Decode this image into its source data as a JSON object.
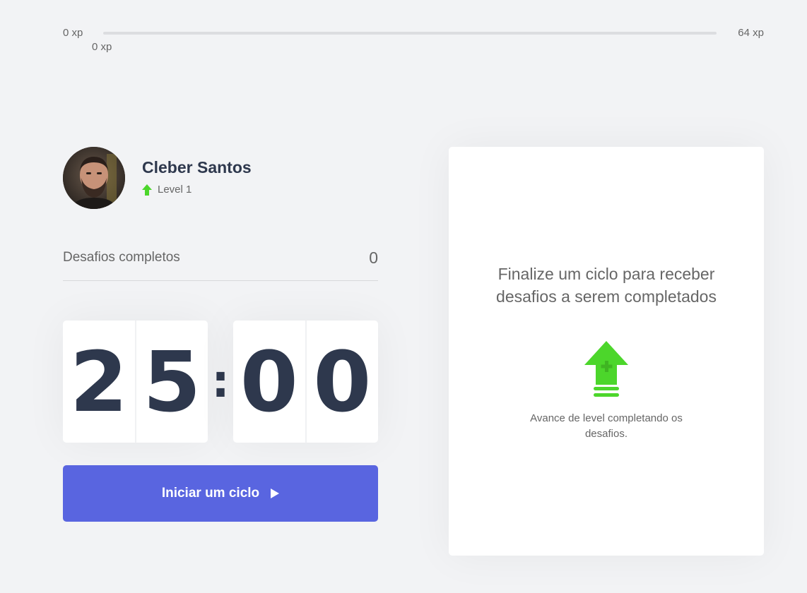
{
  "xp": {
    "min_label": "0 xp",
    "max_label": "64 xp",
    "current_label": "0 xp",
    "progress_percent": 0
  },
  "profile": {
    "name": "Cleber Santos",
    "level_label": "Level 1",
    "avatar_alt": "avatar"
  },
  "challenges": {
    "completed_label": "Desafios completos",
    "completed_value": "0"
  },
  "countdown": {
    "minute_left": "2",
    "minute_right": "5",
    "separator": ":",
    "second_left": "0",
    "second_right": "0"
  },
  "actions": {
    "start_label": "Iniciar um ciclo"
  },
  "challenge_card": {
    "title": "Finalize um ciclo para receber desafios a serem completados",
    "hint": "Avance de level completando os desafios."
  },
  "colors": {
    "background": "#f2f3f5",
    "accent_green": "#4cd62b",
    "button_blue": "#5965e0",
    "title_dark": "#2e384d",
    "text_gray": "#666666"
  },
  "icons": {
    "level": "level-up-arrow-icon",
    "play": "play-icon",
    "card": "level-up-icon"
  }
}
